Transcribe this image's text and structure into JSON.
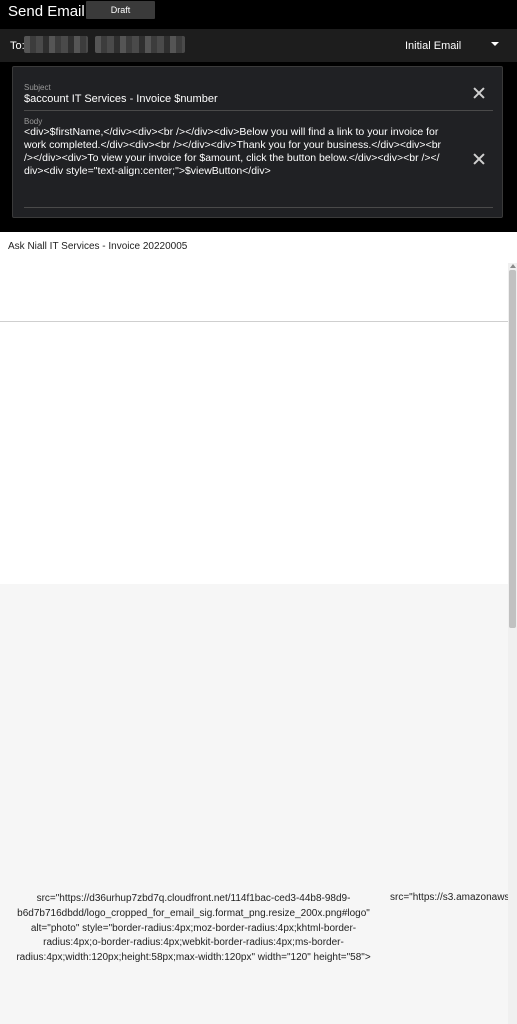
{
  "header": {
    "title": "Send Email",
    "draft_label": "Draft"
  },
  "recipient": {
    "to_label": "To:",
    "template_value": "Initial Email"
  },
  "editor": {
    "subject_label": "Subject",
    "subject_value": "$account IT Services - Invoice $number",
    "body_label": "Body",
    "body_value": "<div>$firstName,</div><div><br /></div><div>Below you will find a link to your invoice for work completed.</div><div><br /></div><div>Thank you for your business.</div><div><br /></div><div>To view your invoice for $amount, click the button below.</div><div><br /></div><div style=\"text-align:center;\">$viewButton</div>"
  },
  "preview": {
    "subject": "Ask Niall IT Services - Invoice 20220005",
    "image_text_1": "src=\"https://d36urhup7zbd7q.cloudfront.net/114f1bac-ced3-44b8-98d9-b6d7b716dbdd/logo_cropped_for_email_sig.format_png.resize_200x.png#logo\" alt=\"photo\" style=\"border-radius:4px;moz-border-radius:4px;khtml-border-radius:4px;o-border-radius:4px;webkit-border-radius:4px;ms-border-radius:4px;width:120px;height:58px;max-width:120px\" width=\"120\" height=\"58\">",
    "image_text_2": "src=\"https://s3.amazonaws"
  },
  "icons": {
    "clear_subject": "close-icon",
    "clear_body": "close-icon",
    "template_caret": "chevron-down-icon"
  },
  "colors": {
    "header_bg": "#000000",
    "panel_bg": "#202124",
    "text_light": "#ffffff"
  }
}
